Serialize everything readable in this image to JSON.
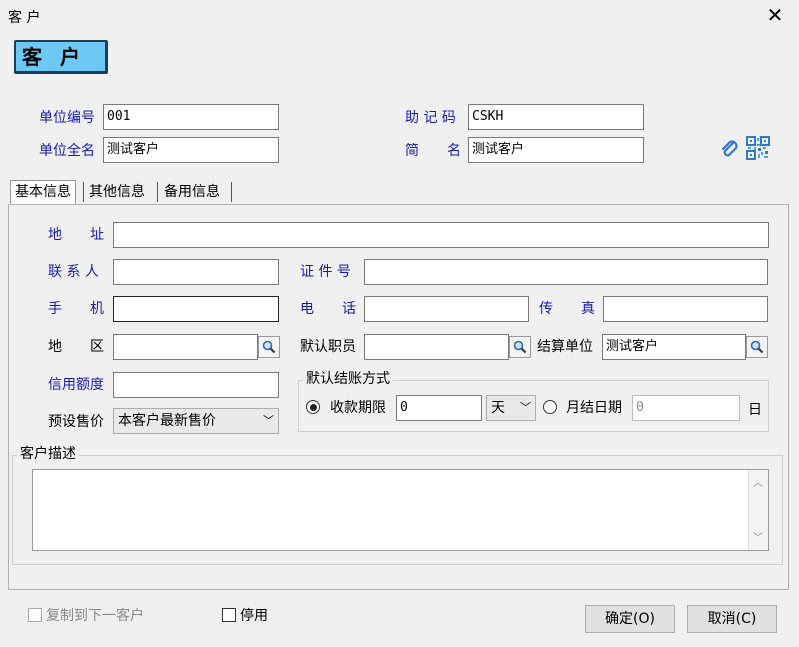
{
  "window": {
    "title": "客 户",
    "close_glyph": "✕"
  },
  "badge": {
    "label": "客户"
  },
  "header": {
    "unit_code_label": "单位编号",
    "unit_code_value": "001",
    "mnemonic_label": "助 记 码",
    "mnemonic_value": "CSKH",
    "full_name_label": "单位全名",
    "full_name_value": "测试客户",
    "short_name_label": "简　　名",
    "short_name_value": "测试客户"
  },
  "icons": {
    "attach": "paperclip-icon",
    "qr": "qr-code-icon",
    "search": "magnifier-icon"
  },
  "tabs": [
    {
      "label": "基本信息"
    },
    {
      "label": "其他信息"
    },
    {
      "label": "备用信息"
    }
  ],
  "basic": {
    "address_label": "地　　址",
    "address_value": "",
    "contact_label": "联 系 人",
    "contact_value": "",
    "id_label": "证 件 号",
    "id_value": "",
    "mobile_label": "手　　机",
    "mobile_value": "",
    "phone_label": "电　　话",
    "phone_value": "",
    "fax_label": "传　　真",
    "fax_value": "",
    "region_label": "地　　区",
    "region_value": "",
    "staff_label": "默认职员",
    "staff_value": "",
    "settle_unit_label": "结算单位",
    "settle_unit_value": "测试客户",
    "credit_label": "信用额度",
    "credit_value": "",
    "price_label": "预设售价",
    "price_value": "本客户最新售价"
  },
  "settlement": {
    "title": "默认结账方式",
    "term_label": "收款期限",
    "term_value": "0",
    "term_unit": "天",
    "monthly_label": "月结日期",
    "monthly_value": "0",
    "day_suffix": "日"
  },
  "description": {
    "title": "客户描述",
    "value": ""
  },
  "footer": {
    "copy_label": "复制到下一客户",
    "disable_label": "停用",
    "ok_label": "确定(O)",
    "cancel_label": "取消(C)"
  },
  "colors": {
    "badge_bg": "#6dc8f4",
    "label_blue": "#1a1ab4"
  }
}
